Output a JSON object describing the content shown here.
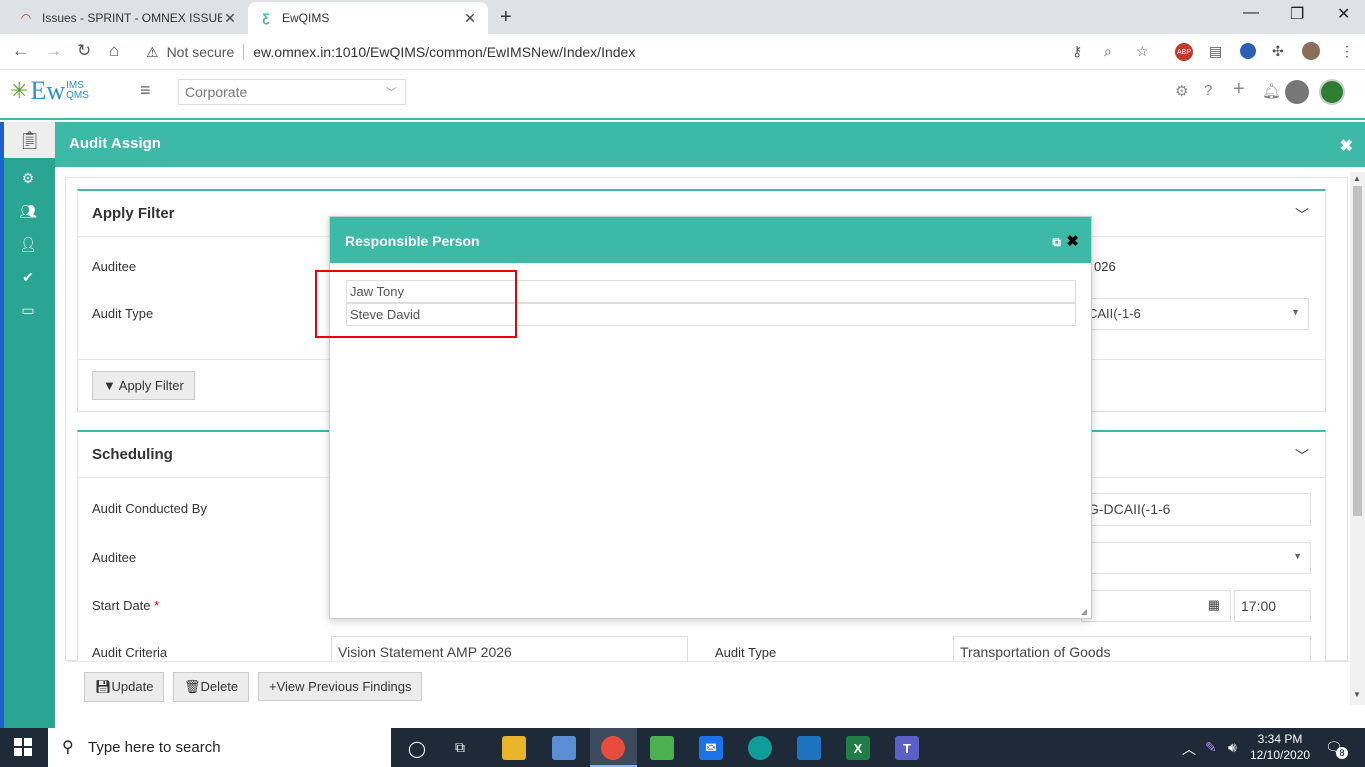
{
  "browser": {
    "tabs": [
      {
        "title": "Issues - SPRINT - OMNEX ISSUE T",
        "active": false
      },
      {
        "title": "EwQIMS",
        "active": true
      }
    ],
    "address": {
      "security": "Not secure",
      "url": "ew.omnex.in:1010/EwQIMS/common/EwIMSNew/Index/Index"
    }
  },
  "app": {
    "logo": {
      "main": "Ew",
      "top": "IMS",
      "bottom": "QMS"
    },
    "org_selector": "Corporate",
    "panel_title": "Audit Assign"
  },
  "filter": {
    "title": "Apply Filter",
    "auditee_label": "Auditee",
    "audit_type_label": "Audit Type",
    "auditee_value_fragment": "026",
    "audit_type_value_fragment": "CAII(-1-6",
    "apply_button": "Apply Filter"
  },
  "scheduling": {
    "title": "Scheduling",
    "audit_conducted_by_label": "Audit Conducted By",
    "auditee_label": "Auditee",
    "start_date_label": "Start Date",
    "required_mark": "*",
    "audit_criteria_label": "Audit Criteria",
    "audit_criteria_value": "Vision Statement AMP 2026",
    "audit_type_label": "Audit Type",
    "audit_type_value": "Transportation of Goods",
    "conducted_value_fragment": "G-DCAII(-1-6",
    "start_time": "17:00"
  },
  "actions": {
    "update": "Update",
    "delete": "Delete",
    "view_previous": "View Previous Findings"
  },
  "modal": {
    "title": "Responsible Person",
    "persons": [
      "Jaw Tony",
      "Steve David"
    ]
  },
  "taskbar": {
    "search_placeholder": "Type here to search",
    "time": "3:34 PM",
    "date": "12/10/2020",
    "notification_count": "8"
  },
  "colors": {
    "accent": "#3db9a8",
    "sidebar": "#2aa493",
    "highlight": "#e00000"
  }
}
